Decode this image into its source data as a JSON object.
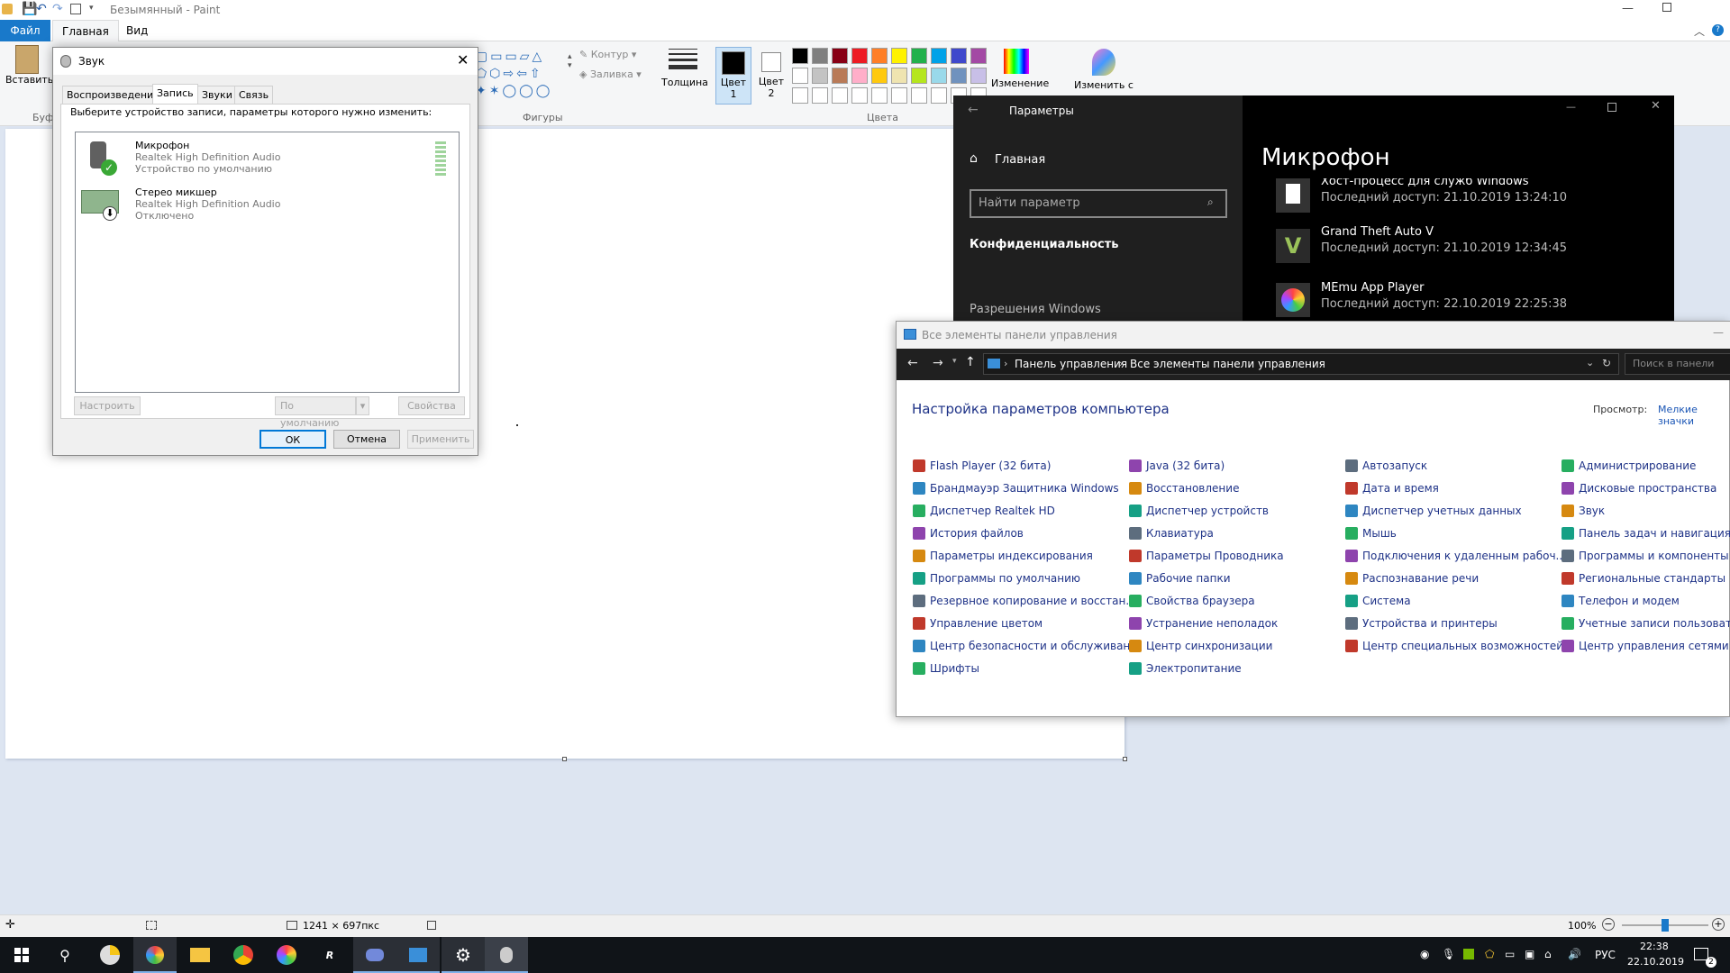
{
  "paint": {
    "title": "Безымянный - Paint",
    "tabs": [
      "Файл",
      "Главная",
      "Вид"
    ],
    "groups": {
      "clipboard_label": "Вставить",
      "clipboard_group": "Буф",
      "shapes": "Фигуры",
      "colors": "Цвета"
    },
    "outline": "Контур",
    "fill": "Заливка",
    "thickness": "Толщина",
    "color1": "Цвет\n1",
    "color2": "Цвет\n2",
    "edit_colors": "Изменение",
    "edit_with": "Изменить с",
    "palette": [
      "#000000",
      "#7f7f7f",
      "#880015",
      "#ed1c24",
      "#ff7f27",
      "#fff200",
      "#22b14c",
      "#00a2e8",
      "#3f48cc",
      "#a349a4",
      "#ffffff",
      "#c3c3c3",
      "#b97a57",
      "#ffaec9",
      "#ffc90e",
      "#efe4b0",
      "#b5e61d",
      "#99d9ea",
      "#7092be",
      "#c8bfe7"
    ],
    "status": {
      "size": "1241 × 697пкс",
      "zoom": "100%"
    }
  },
  "sound": {
    "title": "Звук",
    "tabs": [
      "Воспроизведение",
      "Запись",
      "Звуки",
      "Связь"
    ],
    "instruction": "Выберите устройство записи, параметры которого нужно изменить:",
    "devices": [
      {
        "name": "Микрофон",
        "driver": "Realtek High Definition Audio",
        "status": "Устройство по умолчанию"
      },
      {
        "name": "Стерео микшер",
        "driver": "Realtek High Definition Audio",
        "status": "Отключено"
      }
    ],
    "configure": "Настроить",
    "default": "По умолчанию",
    "properties": "Свойства",
    "ok": "ОК",
    "cancel": "Отмена",
    "apply": "Применить"
  },
  "settings": {
    "title": "Параметры",
    "home": "Главная",
    "search_placeholder": "Найти параметр",
    "section": "Конфиденциальность",
    "perm": "Разрешения Windows",
    "header": "Микрофон",
    "apps": [
      {
        "name": "Хост-процесс для служб Windows",
        "access": "Последний доступ: 21.10.2019 13:24:10"
      },
      {
        "name": "Grand Theft Auto V",
        "access": "Последний доступ: 21.10.2019 12:34:45"
      },
      {
        "name": "MEmu App Player",
        "access": "Последний доступ: 22.10.2019 22:25:38"
      }
    ]
  },
  "cpanel": {
    "title": "Все элементы панели управления",
    "breadcrumb": [
      "Панель управления",
      "Все элементы панели управления"
    ],
    "search_placeholder": "Поиск в панели",
    "heading": "Настройка параметров компьютера",
    "view_label": "Просмотр:",
    "view_value": "Мелкие значки",
    "columns": [
      [
        "Flash Player (32 бита)",
        "Брандмауэр Защитника Windows",
        "Диспетчер Realtek HD",
        "История файлов",
        "Параметры индексирования",
        "Программы по умолчанию",
        "Резервное копирование и восстан...",
        "Управление цветом",
        "Центр безопасности и обслуживан...",
        "Шрифты"
      ],
      [
        "Java (32 бита)",
        "Восстановление",
        "Диспетчер устройств",
        "Клавиатура",
        "Параметры Проводника",
        "Рабочие папки",
        "Свойства браузера",
        "Устранение неполадок",
        "Центр синхронизации",
        "Электропитание"
      ],
      [
        "Автозапуск",
        "Дата и время",
        "Диспетчер учетных данных",
        "Мышь",
        "Подключения к удаленным рабоч...",
        "Распознавание речи",
        "Система",
        "Устройства и принтеры",
        "Центр специальных возможностей"
      ],
      [
        "Администрирование",
        "Дисковые пространства",
        "Звук",
        "Панель задач и навигация",
        "Программы и компоненты",
        "Региональные стандарты",
        "Телефон и модем",
        "Учетные записи пользователей",
        "Центр управления сетями и об"
      ]
    ]
  },
  "taskbar": {
    "lang": "РУС",
    "time": "22:38",
    "date": "22.10.2019",
    "notif": "2"
  }
}
